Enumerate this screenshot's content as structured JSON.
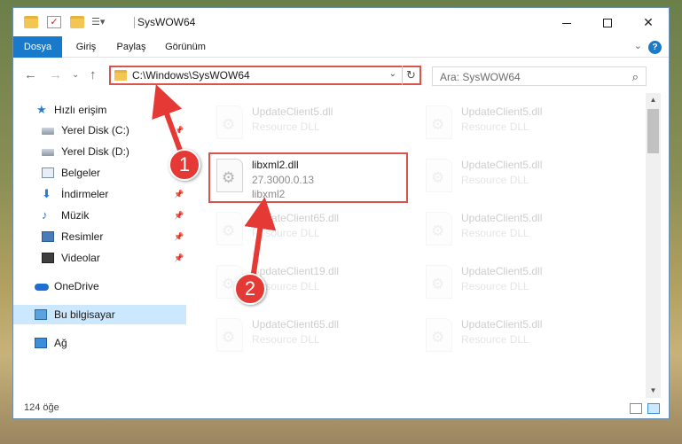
{
  "window": {
    "title": "SysWOW64",
    "minimize_glyph": "",
    "maximize_glyph": "",
    "close_glyph": "✕"
  },
  "ribbon": {
    "tabs": [
      "Dosya",
      "Giriş",
      "Paylaş",
      "Görünüm"
    ],
    "expand_glyph": "⌄",
    "help_glyph": "?"
  },
  "nav": {
    "back_glyph": "←",
    "forward_glyph": "→",
    "recent_glyph": "⌄",
    "up_glyph": "↑",
    "address": "C:\\Windows\\SysWOW64",
    "address_dropdown_glyph": "⌄",
    "refresh_glyph": "↻",
    "search_placeholder": "Ara: SysWOW64",
    "search_glyph": "⌕"
  },
  "sidebar": {
    "items": [
      {
        "label": "Hızlı erişim",
        "icon": "star-icon"
      },
      {
        "label": "Yerel Disk (C:)",
        "icon": "drive-icon",
        "pinned": true
      },
      {
        "label": "Yerel Disk (D:)",
        "icon": "drive-icon",
        "pinned": true
      },
      {
        "label": "Belgeler",
        "icon": "documents-icon",
        "pinned": true
      },
      {
        "label": "İndirmeler",
        "icon": "downloads-icon",
        "pinned": true
      },
      {
        "label": "Müzik",
        "icon": "music-icon",
        "pinned": true
      },
      {
        "label": "Resimler",
        "icon": "pictures-icon",
        "pinned": true
      },
      {
        "label": "Videolar",
        "icon": "videos-icon",
        "pinned": true
      },
      {
        "label": "OneDrive",
        "icon": "onedrive-icon"
      },
      {
        "label": "Bu bilgisayar",
        "icon": "this-pc-icon",
        "selected": true
      },
      {
        "label": "Ağ",
        "icon": "network-icon"
      }
    ],
    "pin_glyph": "📌"
  },
  "files": [
    {
      "name": "UpdateClient5.dll",
      "sub": "Resource DLL",
      "faded": true
    },
    {
      "name": "UpdateClient5.dll",
      "sub": "Resource DLL",
      "faded": true
    },
    {
      "name": "libxml2.dll",
      "version": "27.3000.0.13",
      "sub": "libxml2",
      "faded": false
    },
    {
      "name": "UpdateClient5.dll",
      "sub": "Resource DLL",
      "faded": true
    },
    {
      "name": "UpdateClient65.dll",
      "sub": "Resource DLL",
      "faded": true
    },
    {
      "name": "UpdateClient5.dll",
      "sub": "Resource DLL",
      "faded": true
    },
    {
      "name": "UpdateClient19.dll",
      "sub": "Resource DLL",
      "faded": true
    },
    {
      "name": "UpdateClient5.dll",
      "sub": "Resource DLL",
      "faded": true
    },
    {
      "name": "UpdateClient65.dll",
      "sub": "Resource DLL",
      "faded": true
    },
    {
      "name": "UpdateClient5.dll",
      "sub": "Resource DLL",
      "faded": true
    }
  ],
  "status": {
    "item_count": "124 öğe"
  },
  "annotations": {
    "step1": "1",
    "step2": "2",
    "color": "#e53935"
  },
  "colors": {
    "accent": "#1979ca",
    "highlight": "#d9534f",
    "selection": "#cce8ff"
  }
}
